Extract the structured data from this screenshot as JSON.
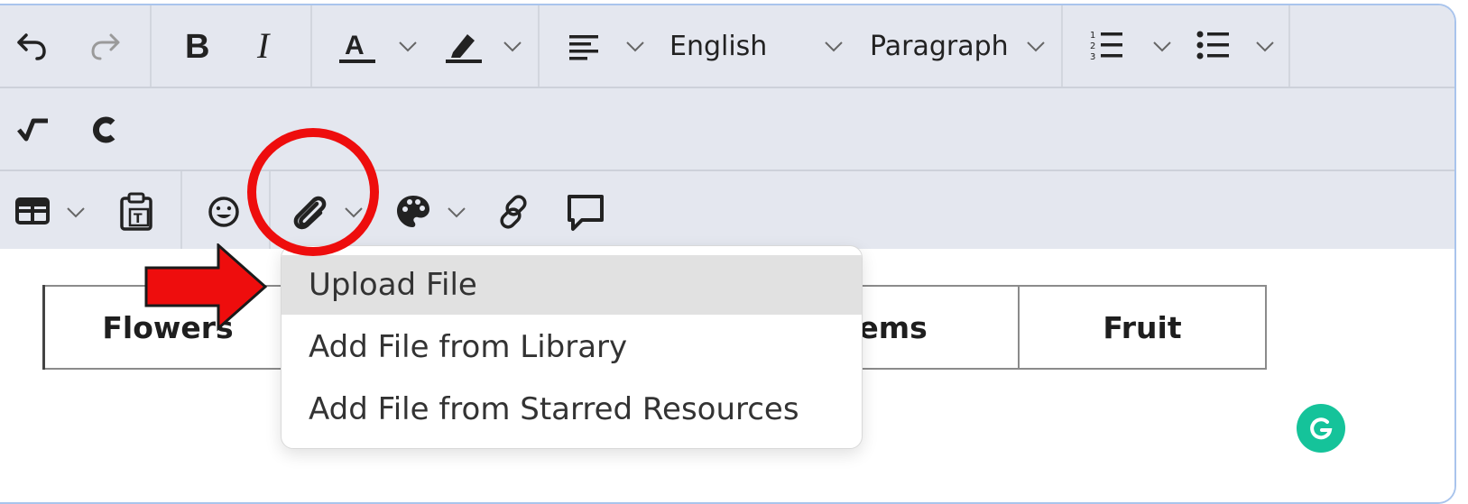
{
  "toolbar": {
    "language_value": "English",
    "block_format_value": "Paragraph",
    "icons": [
      "undo-icon",
      "redo-icon",
      "bold-icon",
      "italic-icon",
      "text-color-icon",
      "highlight-icon",
      "align-icon",
      "numbered-list-icon",
      "bullet-list-icon",
      "math-icon",
      "chemistry-icon",
      "table-icon",
      "paste-text-icon",
      "emoji-icon",
      "attachment-icon",
      "palette-icon",
      "link-icon",
      "comment-icon"
    ]
  },
  "attach_menu": {
    "items": [
      "Upload File",
      "Add File from Library",
      "Add File from Starred Resources"
    ],
    "highlighted": "Upload File"
  },
  "table": {
    "headers": [
      "Flowers",
      "Items",
      "Fruit"
    ]
  },
  "annotation": {
    "circle_color": "#ee0d0d",
    "arrow_color": "#ee0d0d"
  },
  "colors": {
    "toolbar_bg": "#e4e7ef",
    "menu_highlight": "#e1e1e1",
    "grammarly": "#15c39a"
  }
}
